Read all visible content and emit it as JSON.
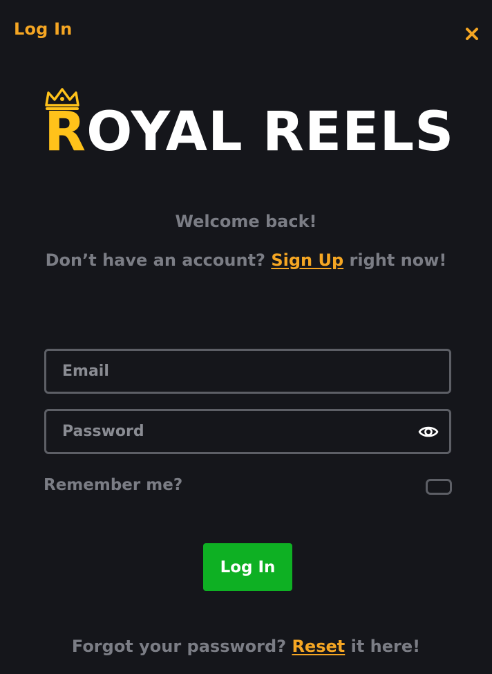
{
  "header": {
    "title": "Log In"
  },
  "logo": {
    "first_letter": "R",
    "rest": "OYAL REELS"
  },
  "intro": {
    "welcome": "Welcome back!",
    "no_account": "Don’t have an account?",
    "signup_link": "Sign Up",
    "signup_suffix": "right now!"
  },
  "form": {
    "email_placeholder": "Email",
    "email_value": "",
    "password_placeholder": "Password",
    "password_value": "",
    "remember_label": "Remember me?",
    "remember_checked": false,
    "submit_label": "Log In"
  },
  "footer": {
    "forgot_text": "Forgot your password?",
    "reset_link": "Reset",
    "reset_suffix": "it here!"
  },
  "icons": {
    "close": "close-icon",
    "eye": "eye-icon",
    "crown": "crown-icon"
  },
  "colors": {
    "background": "#15161b",
    "accent": "#f5a623",
    "logo_gold": "#ffc21a",
    "button_green": "#0eb023",
    "muted_text": "#7b7d85",
    "field_border": "#5d5f66"
  }
}
